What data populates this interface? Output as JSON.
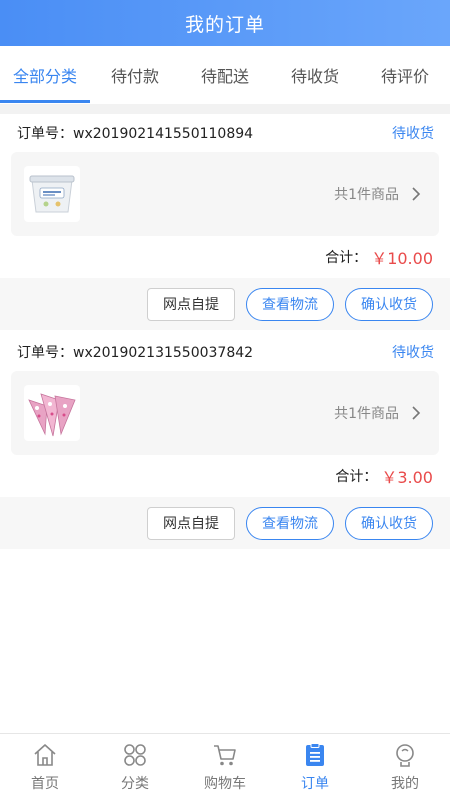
{
  "header": {
    "title": "我的订单"
  },
  "tabs": [
    {
      "label": "全部分类",
      "active": true
    },
    {
      "label": "待付款",
      "active": false
    },
    {
      "label": "待配送",
      "active": false
    },
    {
      "label": "待收货",
      "active": false
    },
    {
      "label": "待评价",
      "active": false
    }
  ],
  "orders": [
    {
      "order_no": "订单号：wx201902141550110894",
      "status": "待收货",
      "product_image": "yogurt-tub",
      "count_text": "共1件商品",
      "total_label": "合计：",
      "total_amount": "￥10.00",
      "buttons": {
        "pickup": "网点自提",
        "logistics": "查看物流",
        "confirm": "确认收货"
      }
    },
    {
      "order_no": "订单号：wx201902131550037842",
      "status": "待收货",
      "product_image": "ice-cream-cones",
      "count_text": "共1件商品",
      "total_label": "合计：",
      "total_amount": "￥3.00",
      "buttons": {
        "pickup": "网点自提",
        "logistics": "查看物流",
        "confirm": "确认收货"
      }
    }
  ],
  "bottom_nav": [
    {
      "label": "首页",
      "icon": "home-icon",
      "active": false
    },
    {
      "label": "分类",
      "icon": "category-icon",
      "active": false
    },
    {
      "label": "购物车",
      "icon": "cart-icon",
      "active": false
    },
    {
      "label": "订单",
      "icon": "order-icon",
      "active": true
    },
    {
      "label": "我的",
      "icon": "profile-icon",
      "active": false
    }
  ],
  "colors": {
    "accent": "#3a86f0",
    "price": "#e94b4b"
  }
}
